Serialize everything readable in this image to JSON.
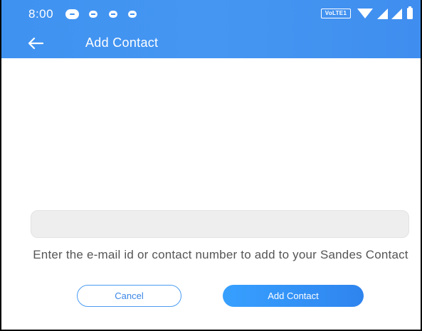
{
  "status_bar": {
    "time": "8:00",
    "network_badge": "VoLTE1",
    "notification_icons": [
      "chat-bubble-icon",
      "notification-icon",
      "notification-icon",
      "notification-icon"
    ]
  },
  "header": {
    "back_icon": "arrow-left-icon",
    "title": "Add Contact"
  },
  "form": {
    "input_value": "",
    "input_placeholder": "",
    "helper_text": "Enter the e-mail id or contact number to add to your Sandes Contact",
    "cancel_label": "Cancel",
    "submit_label": "Add Contact"
  },
  "colors": {
    "app_bar": "#4596f2",
    "primary": "#2f84ee",
    "outline": "#4a9bf3"
  }
}
